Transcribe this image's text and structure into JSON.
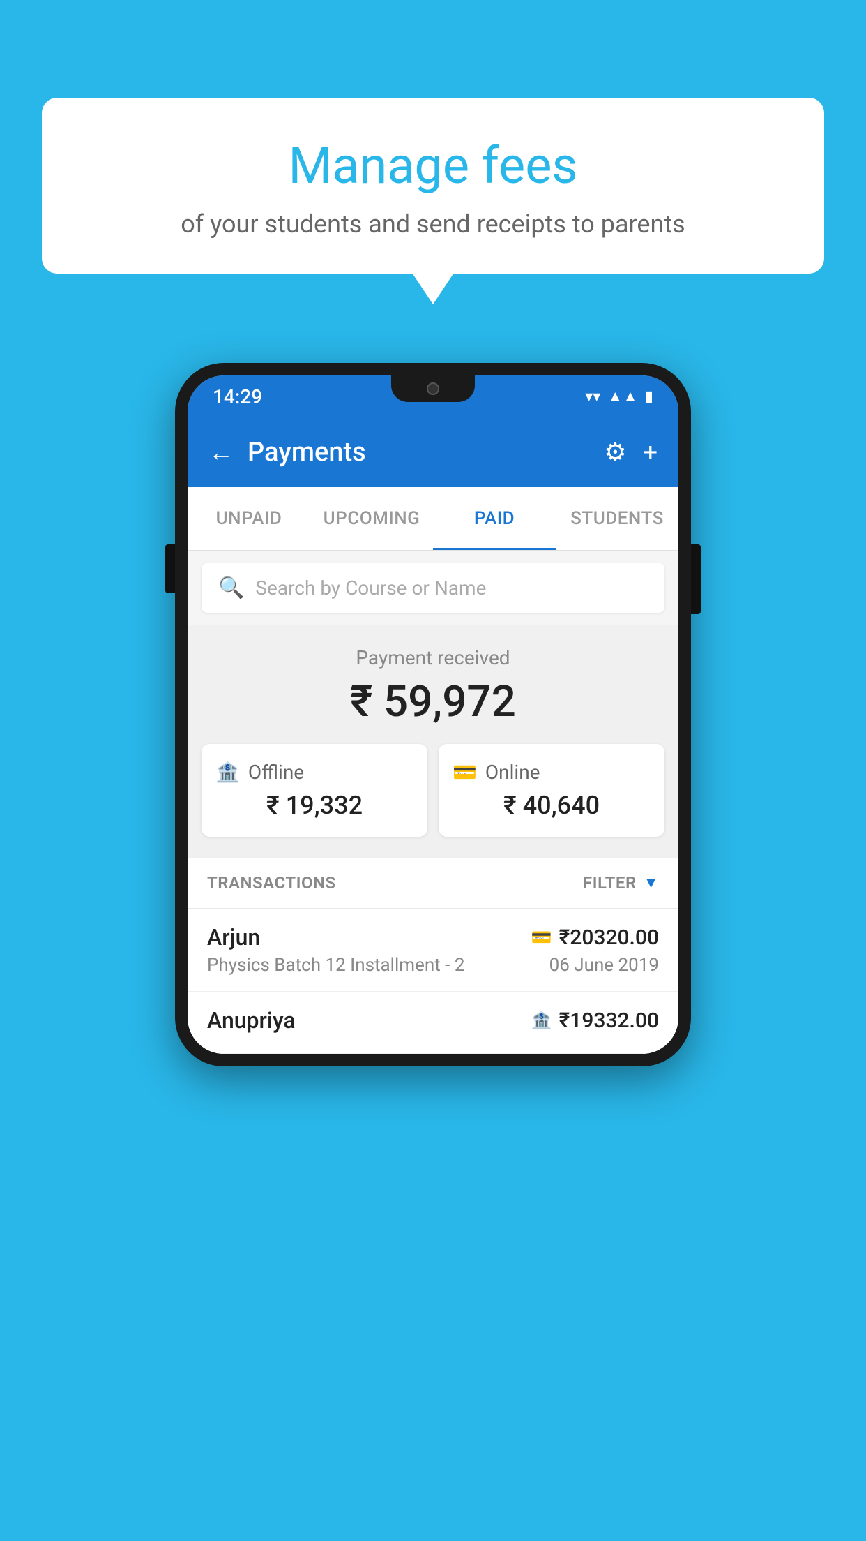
{
  "background_color": "#29b6e8",
  "bubble": {
    "title": "Manage fees",
    "subtitle": "of your students and send receipts to parents"
  },
  "status_bar": {
    "time": "14:29",
    "icons": [
      "wifi",
      "signal",
      "battery"
    ]
  },
  "app_bar": {
    "title": "Payments",
    "back_label": "←",
    "gear_label": "⚙",
    "plus_label": "+"
  },
  "tabs": [
    {
      "label": "UNPAID",
      "active": false
    },
    {
      "label": "UPCOMING",
      "active": false
    },
    {
      "label": "PAID",
      "active": true
    },
    {
      "label": "STUDENTS",
      "active": false
    }
  ],
  "search": {
    "placeholder": "Search by Course or Name"
  },
  "payment_received": {
    "label": "Payment received",
    "amount": "₹ 59,972",
    "offline": {
      "type": "Offline",
      "amount": "₹ 19,332"
    },
    "online": {
      "type": "Online",
      "amount": "₹ 40,640"
    }
  },
  "transactions": {
    "label": "TRANSACTIONS",
    "filter_label": "FILTER",
    "rows": [
      {
        "name": "Arjun",
        "amount": "₹20320.00",
        "description": "Physics Batch 12 Installment - 2",
        "date": "06 June 2019",
        "payment_type": "card"
      },
      {
        "name": "Anupriya",
        "amount": "₹19332.00",
        "description": "",
        "date": "",
        "payment_type": "cash"
      }
    ]
  }
}
